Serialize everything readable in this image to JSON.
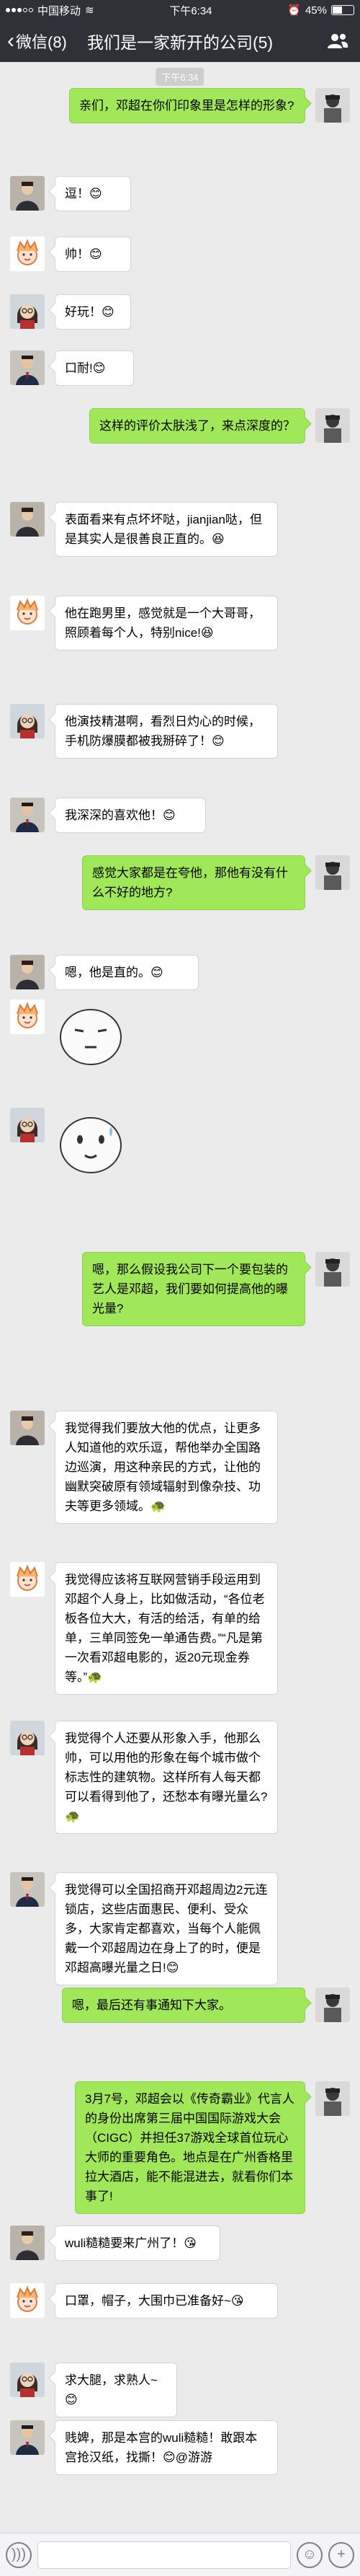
{
  "status_bar": {
    "carrier": "中国移动",
    "wifi": "≋",
    "time": "下午6:34",
    "battery_text": "45%",
    "battery_level": 0.45
  },
  "nav": {
    "back_label": "微信(8)",
    "title": "我们是一家新开的公司(5)"
  },
  "timestamp": "下午6:34",
  "messages": [
    {
      "side": "right",
      "avatar": "avatar-self",
      "text": "亲们，邓超在你们印象里是怎样的形象?"
    },
    {
      "side": "left",
      "avatar": "avatar-man-suit",
      "text": "逗！😊"
    },
    {
      "side": "left",
      "avatar": "avatar-cartoon-girl",
      "text": "帅！😊"
    },
    {
      "side": "left",
      "avatar": "avatar-girl-glasses",
      "text": "好玩！😊"
    },
    {
      "side": "left",
      "avatar": "avatar-man-suit2",
      "text": "口耐!😊"
    },
    {
      "side": "right",
      "avatar": "avatar-self",
      "text": "这样的评价太肤浅了，来点深度的？"
    },
    {
      "side": "left",
      "avatar": "avatar-man-suit",
      "text": "表面看来有点坏坏哒，jianjian哒，但是其实人是很善良正直的。😆"
    },
    {
      "side": "left",
      "avatar": "avatar-cartoon-girl",
      "text": "他在跑男里，感觉就是一个大哥哥，照顾着每个人，特别nice!😆"
    },
    {
      "side": "left",
      "avatar": "avatar-girl-glasses",
      "text": "他演技精湛啊，看烈日灼心的时候，手机防爆膜都被我掰碎了！😊"
    },
    {
      "side": "left",
      "avatar": "avatar-man-suit2",
      "text": "我深深的喜欢他！😊"
    },
    {
      "side": "right",
      "avatar": "avatar-self",
      "text": "感觉大家都是在夸他，那他有没有什么不好的地方?"
    },
    {
      "side": "left",
      "avatar": "avatar-man-suit",
      "text": "嗯，他是直的。😊"
    },
    {
      "side": "left",
      "avatar": "avatar-cartoon-girl",
      "sticker": "sticker-meh-face"
    },
    {
      "side": "left",
      "avatar": "avatar-girl-glasses",
      "sticker": "sticker-sweat-face"
    },
    {
      "side": "right",
      "avatar": "avatar-self",
      "text": "嗯，那么假设我公司下一个要包装的艺人是邓超，我们要如何提高他的曝光量?"
    },
    {
      "side": "left",
      "avatar": "avatar-man-suit",
      "text": "我觉得我们要放大他的优点，让更多人知道他的欢乐逗，帮他举办全国路边巡演，用这种亲民的方式，让他的幽默突破原有领域辐射到像杂技、功夫等更多领域。🐢"
    },
    {
      "side": "left",
      "avatar": "avatar-cartoon-girl",
      "text": "我觉得应该将互联网营销手段运用到邓超个人身上，比如做活动，“各位老板各位大大，有活的给活，有单的给单，三单同签免一单通告费。”“凡是第一次看邓超电影的，返20元现金券等。”🐢"
    },
    {
      "side": "left",
      "avatar": "avatar-girl-glasses",
      "text": "我觉得个人还要从形象入手，他那么帅，可以用他的形象在每个城市做个标志性的建筑物。这样所有人每天都可以看得到他了，还愁本有曝光量么?🐢"
    },
    {
      "side": "left",
      "avatar": "avatar-man-suit2",
      "text": "我觉得可以全国招商开邓超周边2元连锁店，这些店面惠民、便利、受众多，大家肯定都喜欢，当每个人能佩戴一个邓超周边在身上了的时，便是邓超高曝光量之日!😊"
    },
    {
      "side": "right",
      "avatar": "avatar-self",
      "text": "嗯，最后还有事通知下大家。"
    },
    {
      "side": "right",
      "avatar": "avatar-self",
      "text": "3月7号，邓超会以《传奇霸业》代言人的身份出席第三届中国国际游戏大会（CIGC）并担任37游戏全球首位玩心大师的重要角色。地点是在广州香格里拉大酒店，能不能混进去，就看你们本事了!"
    },
    {
      "side": "left",
      "avatar": "avatar-man-suit",
      "text": "wuli糙糙要来广州了！😘"
    },
    {
      "side": "left",
      "avatar": "avatar-cartoon-girl",
      "text": "口罩，帽子，大围巾已准备好~😘"
    },
    {
      "side": "left",
      "avatar": "avatar-girl-glasses",
      "text": "求大腿，求熟人~😊"
    },
    {
      "side": "left",
      "avatar": "avatar-man-suit2",
      "text": "贱婢，那是本宫的wuli糙糙！敢跟本宫抢汉纸，找撕！😊@游游"
    }
  ],
  "input_bar": {
    "voice_icon": "voice-icon",
    "emoji_icon": "emoji-icon",
    "plus_icon": "plus-icon"
  }
}
